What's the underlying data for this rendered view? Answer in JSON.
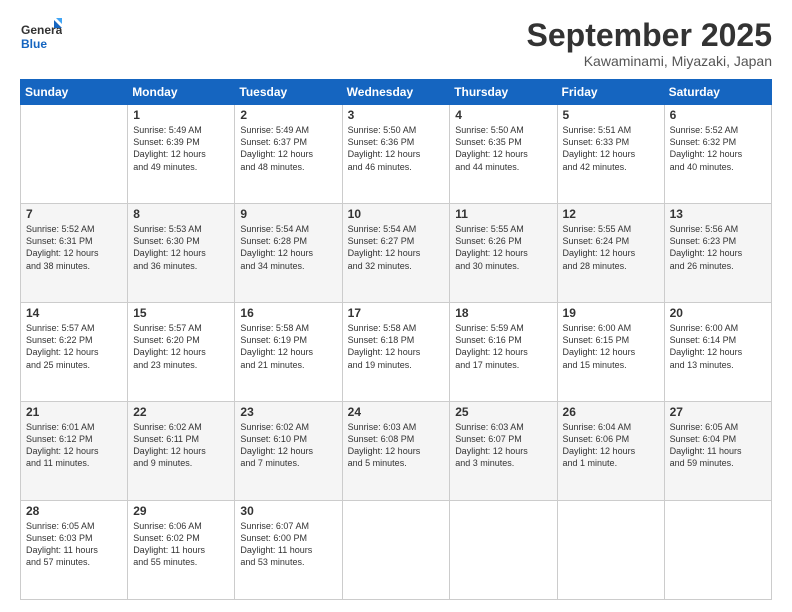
{
  "logo": {
    "line1": "General",
    "line2": "Blue"
  },
  "header": {
    "month": "September 2025",
    "location": "Kawaminami, Miyazaki, Japan"
  },
  "weekdays": [
    "Sunday",
    "Monday",
    "Tuesday",
    "Wednesday",
    "Thursday",
    "Friday",
    "Saturday"
  ],
  "weeks": [
    [
      {
        "day": "",
        "info": ""
      },
      {
        "day": "1",
        "info": "Sunrise: 5:49 AM\nSunset: 6:39 PM\nDaylight: 12 hours\nand 49 minutes."
      },
      {
        "day": "2",
        "info": "Sunrise: 5:49 AM\nSunset: 6:37 PM\nDaylight: 12 hours\nand 48 minutes."
      },
      {
        "day": "3",
        "info": "Sunrise: 5:50 AM\nSunset: 6:36 PM\nDaylight: 12 hours\nand 46 minutes."
      },
      {
        "day": "4",
        "info": "Sunrise: 5:50 AM\nSunset: 6:35 PM\nDaylight: 12 hours\nand 44 minutes."
      },
      {
        "day": "5",
        "info": "Sunrise: 5:51 AM\nSunset: 6:33 PM\nDaylight: 12 hours\nand 42 minutes."
      },
      {
        "day": "6",
        "info": "Sunrise: 5:52 AM\nSunset: 6:32 PM\nDaylight: 12 hours\nand 40 minutes."
      }
    ],
    [
      {
        "day": "7",
        "info": "Sunrise: 5:52 AM\nSunset: 6:31 PM\nDaylight: 12 hours\nand 38 minutes."
      },
      {
        "day": "8",
        "info": "Sunrise: 5:53 AM\nSunset: 6:30 PM\nDaylight: 12 hours\nand 36 minutes."
      },
      {
        "day": "9",
        "info": "Sunrise: 5:54 AM\nSunset: 6:28 PM\nDaylight: 12 hours\nand 34 minutes."
      },
      {
        "day": "10",
        "info": "Sunrise: 5:54 AM\nSunset: 6:27 PM\nDaylight: 12 hours\nand 32 minutes."
      },
      {
        "day": "11",
        "info": "Sunrise: 5:55 AM\nSunset: 6:26 PM\nDaylight: 12 hours\nand 30 minutes."
      },
      {
        "day": "12",
        "info": "Sunrise: 5:55 AM\nSunset: 6:24 PM\nDaylight: 12 hours\nand 28 minutes."
      },
      {
        "day": "13",
        "info": "Sunrise: 5:56 AM\nSunset: 6:23 PM\nDaylight: 12 hours\nand 26 minutes."
      }
    ],
    [
      {
        "day": "14",
        "info": "Sunrise: 5:57 AM\nSunset: 6:22 PM\nDaylight: 12 hours\nand 25 minutes."
      },
      {
        "day": "15",
        "info": "Sunrise: 5:57 AM\nSunset: 6:20 PM\nDaylight: 12 hours\nand 23 minutes."
      },
      {
        "day": "16",
        "info": "Sunrise: 5:58 AM\nSunset: 6:19 PM\nDaylight: 12 hours\nand 21 minutes."
      },
      {
        "day": "17",
        "info": "Sunrise: 5:58 AM\nSunset: 6:18 PM\nDaylight: 12 hours\nand 19 minutes."
      },
      {
        "day": "18",
        "info": "Sunrise: 5:59 AM\nSunset: 6:16 PM\nDaylight: 12 hours\nand 17 minutes."
      },
      {
        "day": "19",
        "info": "Sunrise: 6:00 AM\nSunset: 6:15 PM\nDaylight: 12 hours\nand 15 minutes."
      },
      {
        "day": "20",
        "info": "Sunrise: 6:00 AM\nSunset: 6:14 PM\nDaylight: 12 hours\nand 13 minutes."
      }
    ],
    [
      {
        "day": "21",
        "info": "Sunrise: 6:01 AM\nSunset: 6:12 PM\nDaylight: 12 hours\nand 11 minutes."
      },
      {
        "day": "22",
        "info": "Sunrise: 6:02 AM\nSunset: 6:11 PM\nDaylight: 12 hours\nand 9 minutes."
      },
      {
        "day": "23",
        "info": "Sunrise: 6:02 AM\nSunset: 6:10 PM\nDaylight: 12 hours\nand 7 minutes."
      },
      {
        "day": "24",
        "info": "Sunrise: 6:03 AM\nSunset: 6:08 PM\nDaylight: 12 hours\nand 5 minutes."
      },
      {
        "day": "25",
        "info": "Sunrise: 6:03 AM\nSunset: 6:07 PM\nDaylight: 12 hours\nand 3 minutes."
      },
      {
        "day": "26",
        "info": "Sunrise: 6:04 AM\nSunset: 6:06 PM\nDaylight: 12 hours\nand 1 minute."
      },
      {
        "day": "27",
        "info": "Sunrise: 6:05 AM\nSunset: 6:04 PM\nDaylight: 11 hours\nand 59 minutes."
      }
    ],
    [
      {
        "day": "28",
        "info": "Sunrise: 6:05 AM\nSunset: 6:03 PM\nDaylight: 11 hours\nand 57 minutes."
      },
      {
        "day": "29",
        "info": "Sunrise: 6:06 AM\nSunset: 6:02 PM\nDaylight: 11 hours\nand 55 minutes."
      },
      {
        "day": "30",
        "info": "Sunrise: 6:07 AM\nSunset: 6:00 PM\nDaylight: 11 hours\nand 53 minutes."
      },
      {
        "day": "",
        "info": ""
      },
      {
        "day": "",
        "info": ""
      },
      {
        "day": "",
        "info": ""
      },
      {
        "day": "",
        "info": ""
      }
    ]
  ]
}
